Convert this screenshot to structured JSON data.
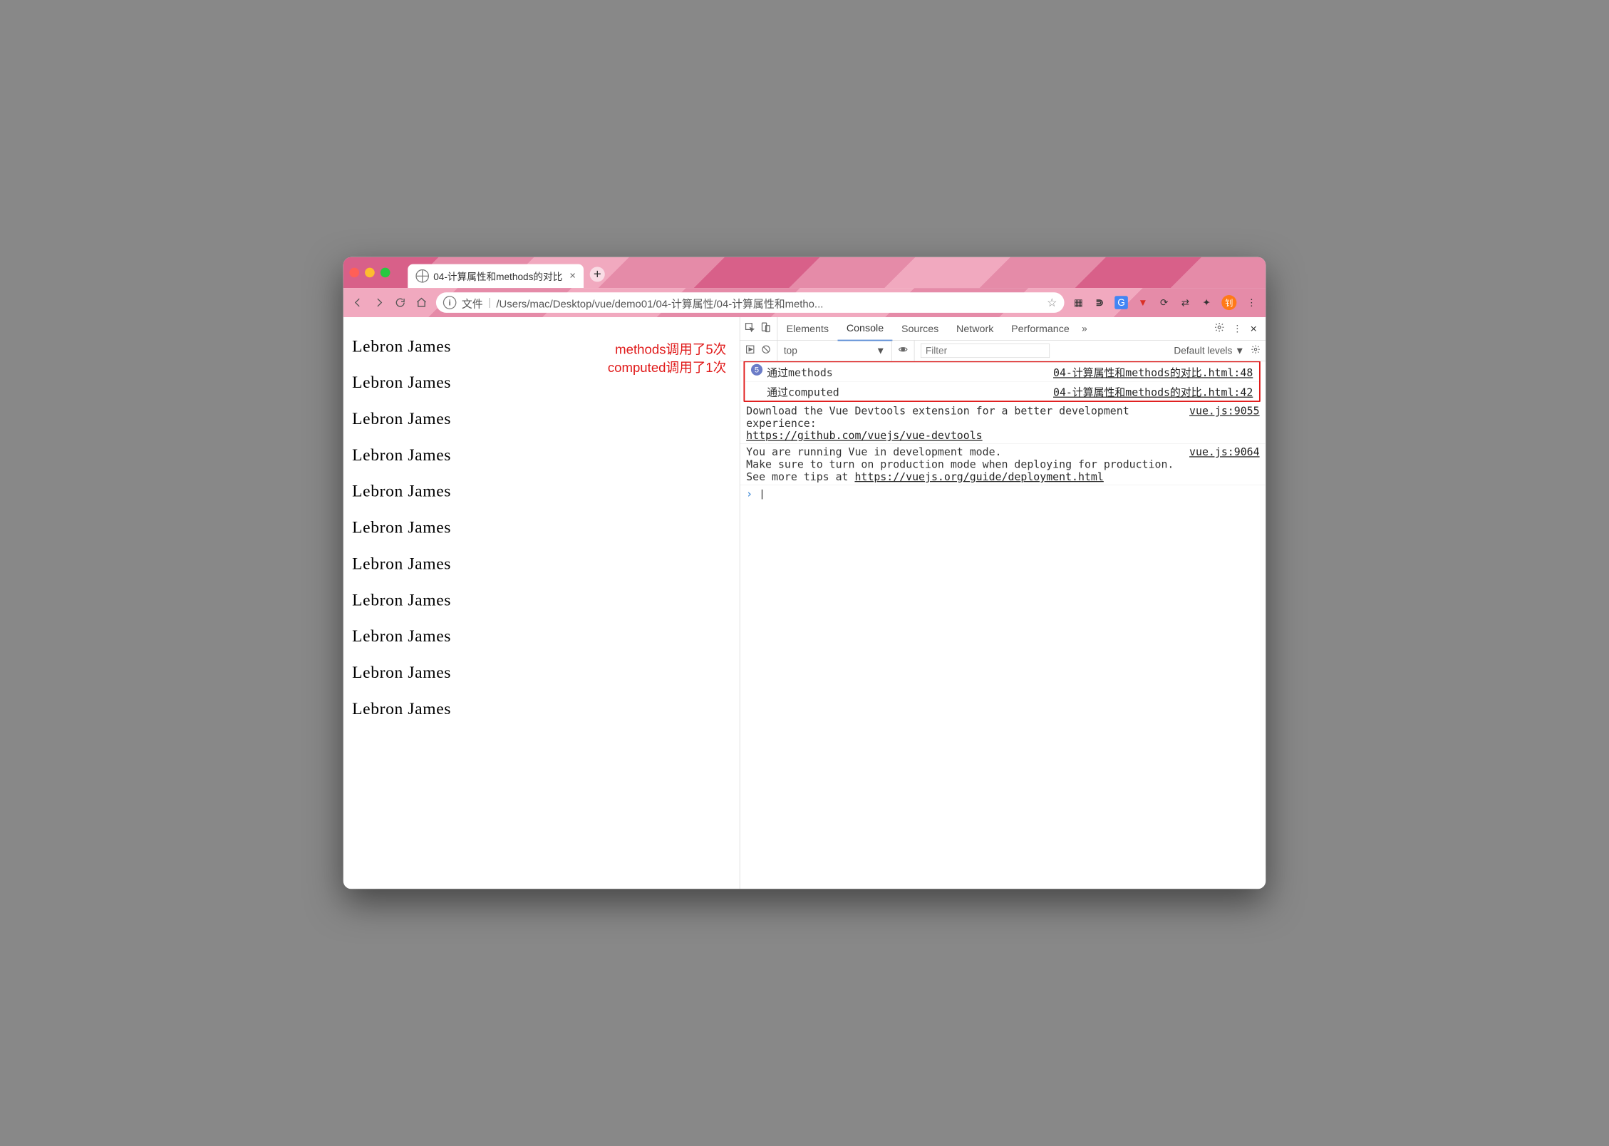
{
  "browser": {
    "tab_title": "04-计算属性和methods的对比",
    "address_prefix": "文件",
    "address_path": "/Users/mac/Desktop/vue/demo01/04-计算属性/04-计算属性和metho..."
  },
  "page": {
    "heading": "Lebron James",
    "repeat": 11,
    "annotation_line1": "methods调用了5次",
    "annotation_line2": "computed调用了1次"
  },
  "devtools": {
    "tabs": {
      "elements": "Elements",
      "console": "Console",
      "sources": "Sources",
      "network": "Network",
      "performance": "Performance"
    },
    "toolbar": {
      "context": "top",
      "filter_ph": "Filter",
      "levels": "Default levels"
    },
    "logs": {
      "l1_count": "5",
      "l1_msg": "通过methods",
      "l1_src": "04-计算属性和methods的对比.html:48",
      "l2_msg": "通过computed",
      "l2_src": "04-计算属性和methods的对比.html:42",
      "l3_msg": "Download the Vue Devtools extension for a better development experience:",
      "l3_link": "https://github.com/vuejs/vue-devtools",
      "l3_src": "vue.js:9055",
      "l4_a": "You are running Vue in development mode.",
      "l4_b": "Make sure to turn on production mode when deploying for production.",
      "l4_c": "See more tips at ",
      "l4_link": "https://vuejs.org/guide/deployment.html",
      "l4_src": "vue.js:9064"
    }
  }
}
